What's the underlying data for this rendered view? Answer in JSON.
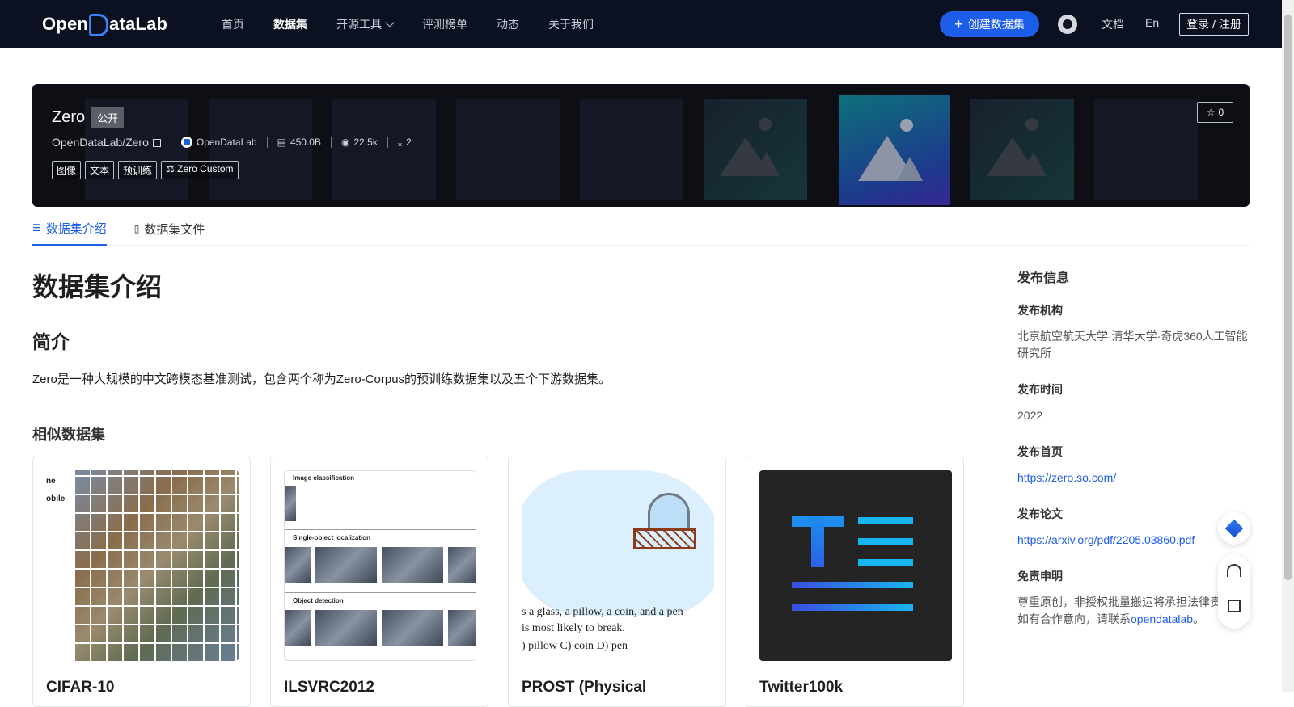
{
  "header": {
    "logo_text_pre": "Open",
    "logo_text_post": "ataLab",
    "nav": [
      "首页",
      "数据集",
      "开源工具",
      "评测榜单",
      "动态",
      "关于我们"
    ],
    "create_label": "创建数据集",
    "docs": "文档",
    "lang": "En",
    "login": "登录 / 注册"
  },
  "dataset": {
    "name": "Zero",
    "visibility": "公开",
    "path": "OpenDataLab/Zero",
    "org": "OpenDataLab",
    "size": "450.0B",
    "views": "22.5k",
    "downloads": "2",
    "tags": [
      "图像",
      "文本",
      "预训练"
    ],
    "license": "Zero Custom",
    "stars": "0"
  },
  "tabs": [
    "数据集介绍",
    "数据集文件"
  ],
  "main": {
    "title": "数据集介绍",
    "intro_heading": "简介",
    "intro_text": "Zero是一种大规模的中文跨模态基准测试，包含两个称为Zero-Corpus的预训练数据集以及五个下游数据集。",
    "similar_heading": "相似数据集"
  },
  "similar": [
    {
      "title": "CIFAR-10"
    },
    {
      "title": "ILSVRC2012"
    },
    {
      "title": "PROST (Physical"
    },
    {
      "title": "Twitter100k"
    }
  ],
  "card_text": {
    "cifar_labels": [
      "ne",
      "obile"
    ],
    "ilsvrc_sections": [
      "Image classification",
      "Single-object localization",
      "Object detection"
    ],
    "prost_q1": "s a glass, a pillow, a coin, and a pen",
    "prost_q2": "is most likely to break.",
    "prost_q3": ") pillow    C) coin       D) pen"
  },
  "sidebar": {
    "title": "发布信息",
    "org_label": "发布机构",
    "org_value": "北京航空航天大学·清华大学·奇虎360人工智能研究所",
    "time_label": "发布时间",
    "time_value": "2022",
    "home_label": "发布首页",
    "home_value": "https://zero.so.com/",
    "paper_label": "发布论文",
    "paper_value": "https://arxiv.org/pdf/2205.03860.pdf",
    "disclaimer_label": "免责申明",
    "disclaimer_text": "尊重原创，非授权批量搬运将承担法律责任，如有合作意向，请联系",
    "disclaimer_link": "opendatalab",
    "disclaimer_end": "。"
  },
  "colors": {
    "accent": "#1d5ee8",
    "nav_bg": "#0b1120"
  }
}
